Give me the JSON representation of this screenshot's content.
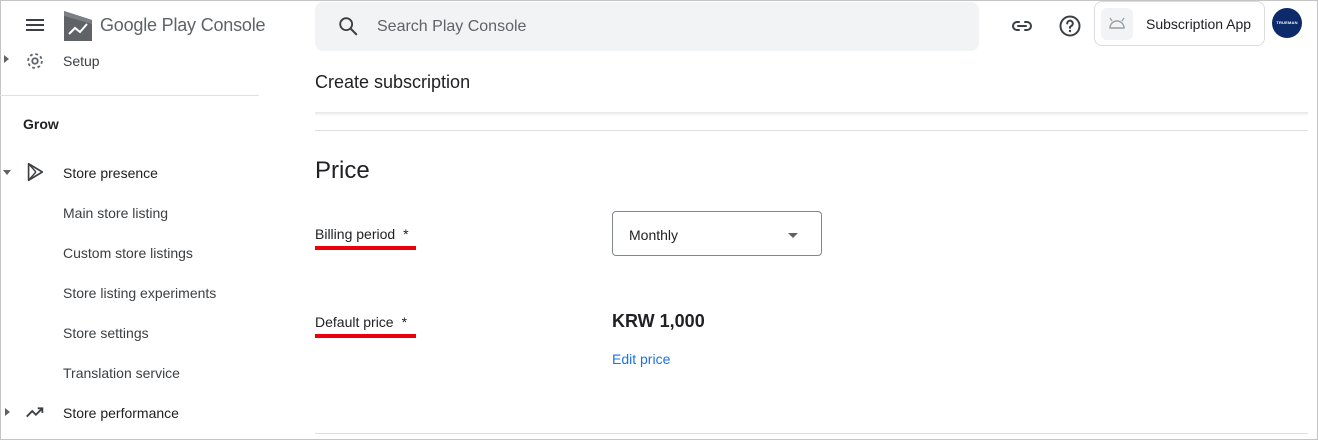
{
  "header": {
    "brand_prefix": "Google Play",
    "brand_suffix": "Console",
    "search_placeholder": "Search Play Console",
    "app_name": "Subscription App",
    "avatar_text": "TRUEMAN"
  },
  "sidebar": {
    "setup_label": "Setup",
    "section_title": "Grow",
    "items": [
      {
        "label": "Store presence",
        "icon": "play-outline-icon",
        "expanded": true
      },
      {
        "label": "Main store listing"
      },
      {
        "label": "Custom store listings"
      },
      {
        "label": "Store listing experiments"
      },
      {
        "label": "Store settings"
      },
      {
        "label": "Translation service"
      },
      {
        "label": "Store performance",
        "icon": "trending-up-icon",
        "expanded": false
      }
    ]
  },
  "main": {
    "page_title": "Create subscription",
    "section_title": "Price",
    "billing_period_label": "Billing period",
    "billing_period_value": "Monthly",
    "default_price_label": "Default price",
    "required_marker": "*",
    "default_price_value": "KRW 1,000",
    "edit_price_label": "Edit price"
  },
  "colors": {
    "accent_link": "#1a73e8",
    "annotation_underline": "#e8000a",
    "avatar_bg": "#0d2a6b"
  }
}
